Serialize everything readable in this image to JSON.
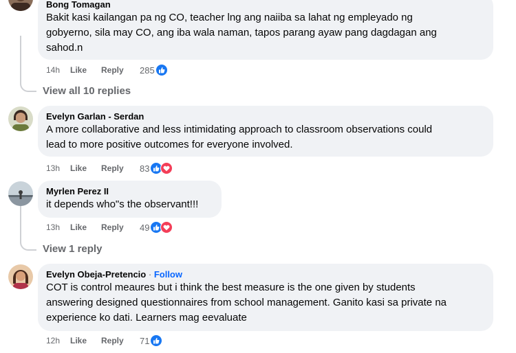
{
  "comments": [
    {
      "author": "Bong Tomagan",
      "lines": [
        "Bakit kasi kailangan pa ng CO, teacher lng ang naiiba sa lahat ng empleyado ng",
        "gobyerno, sila may CO, ang iba wala naman, tapos parang ayaw pang dagdagan ang",
        "sahod.n"
      ],
      "time": "14h",
      "like": "Like",
      "reply": "Reply",
      "reactions": "285"
    },
    {
      "author": "Evelyn Garlan - Serdan",
      "lines": [
        "A more collaborative and less intimidating approach to classroom observations could",
        "lead to more positive outcomes for everyone involved."
      ],
      "time": "13h",
      "like": "Like",
      "reply": "Reply",
      "reactions": "83"
    },
    {
      "author": "Myrlen Perez II",
      "lines": [
        "it depends who\"s the observant!!!"
      ],
      "time": "13h",
      "like": "Like",
      "reply": "Reply",
      "reactions": "49"
    },
    {
      "author": "Evelyn Obeja-Pretencio",
      "separator": "·",
      "follow": "Follow",
      "lines": [
        "COT is control meaures but i think the best measure is the one given by students",
        "answering designed questionnaires from school management. Ganito kasi sa private na",
        "experience ko dati. Learners mag eevaluate"
      ],
      "time": "12h",
      "like": "Like",
      "reply": "Reply",
      "reactions": "71"
    }
  ],
  "view_replies": [
    "View all 10 replies",
    "View 1 reply"
  ],
  "colors": {
    "bubble": "#f0f2f5",
    "like_blue": "#1877f2",
    "heart_red": "#f33e58",
    "meta_gray": "#65676b",
    "follow_blue": "#0866ff"
  },
  "icons": [
    "avatar",
    "like-reaction-icon",
    "love-reaction-icon"
  ]
}
